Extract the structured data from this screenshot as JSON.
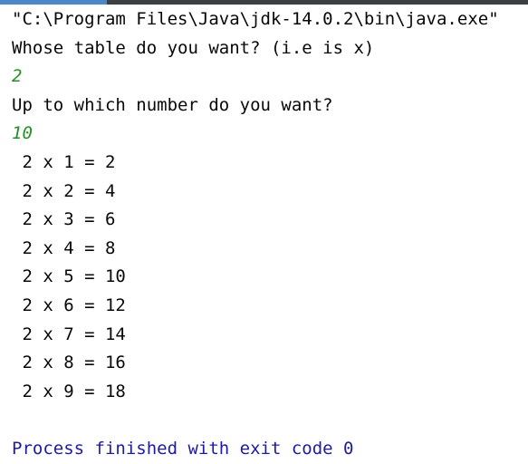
{
  "console": {
    "command": "\"C:\\Program Files\\Java\\jdk-14.0.2\\bin\\java.exe\"",
    "prompt_table": "Whose table do you want? (i.e is x)",
    "input_table": "2",
    "prompt_limit": "Up to which number do you want?",
    "input_limit": "10",
    "results": [
      " 2 x 1 = 2",
      " 2 x 2 = 4",
      " 2 x 3 = 6",
      " 2 x 4 = 8",
      " 2 x 5 = 10",
      " 2 x 6 = 12",
      " 2 x 7 = 14",
      " 2 x 8 = 16",
      " 2 x 9 = 18"
    ],
    "finish_message": "Process finished with exit code 0"
  },
  "colors": {
    "background": "#ffffff",
    "text": "#080808",
    "user_input": "#248f24",
    "process_finished": "#1c1ca1"
  }
}
